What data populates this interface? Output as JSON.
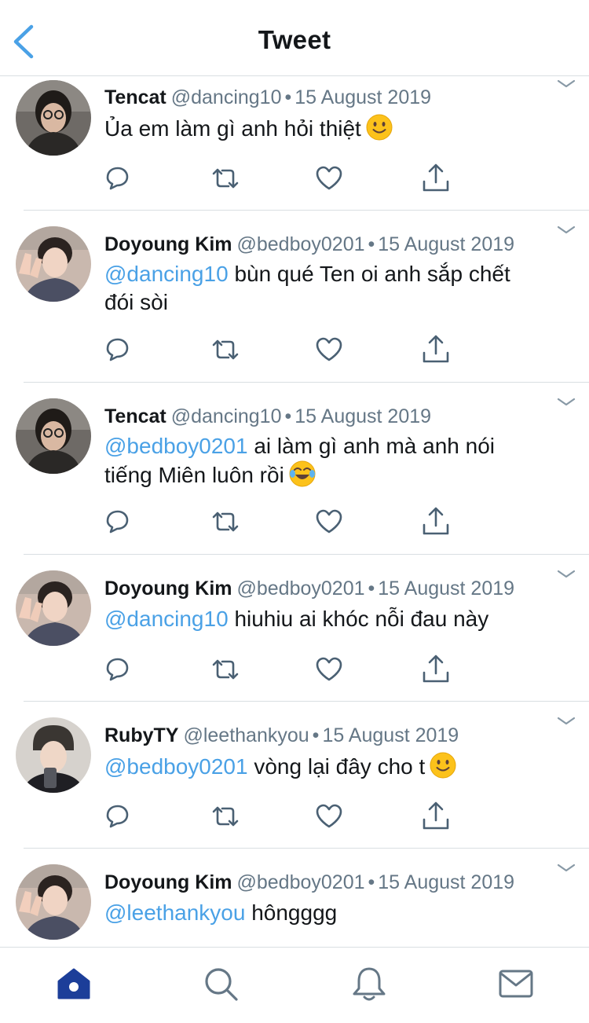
{
  "header": {
    "title": "Tweet"
  },
  "tweets": [
    {
      "name": "Tencat",
      "handle": "@dancing10",
      "date": "15 August 2019",
      "mention": "",
      "text": "Ủa em làm gì anh hỏi thiệt",
      "emoji": "slight-smile",
      "text2": ""
    },
    {
      "name": "Doyoung Kim",
      "handle": "@bedboy0201",
      "date": "15 August 2019",
      "mention": "@dancing10",
      "text": "bùn qué Ten oi anh sắp chết",
      "emoji": "",
      "text2": "đói sòi"
    },
    {
      "name": "Tencat",
      "handle": "@dancing10",
      "date": "15 August 2019",
      "mention": "@bedboy0201",
      "text": "ai làm gì anh mà anh nói",
      "emoji": "laugh-cry",
      "text2": "tiếng Miên luôn rồi"
    },
    {
      "name": "Doyoung Kim",
      "handle": "@bedboy0201",
      "date": "15 August 2019",
      "mention": "@dancing10",
      "text": "hiuhiu ai khóc nỗi đau này",
      "emoji": "",
      "text2": ""
    },
    {
      "name": "RubyTY",
      "handle": "@leethankyou",
      "date": "15 August 2019",
      "mention": "@bedboy0201",
      "text": "vòng lại đây cho t",
      "emoji": "slight-smile",
      "text2": ""
    },
    {
      "name": "Doyoung Kim",
      "handle": "@bedboy0201",
      "date": "15 August 2019",
      "mention": "@leethankyou",
      "text": "hôngggg",
      "emoji": "",
      "text2": ""
    }
  ],
  "meta": {
    "separator": "•"
  },
  "icons": {
    "back": "chevron-left-icon",
    "menu": "chevron-down-icon",
    "actions": [
      "reply-icon",
      "retweet-icon",
      "like-icon",
      "share-icon"
    ],
    "tabs": [
      "home-icon",
      "search-icon",
      "notifications-icon",
      "messages-icon"
    ]
  },
  "colors": {
    "accent": "#1da1f2",
    "mention": "#4aa1e6",
    "text": "#14171a",
    "secondary": "#657786",
    "divider": "#d9dee2",
    "tab_active": "#1c3e99",
    "tab_inactive": "#657786"
  }
}
